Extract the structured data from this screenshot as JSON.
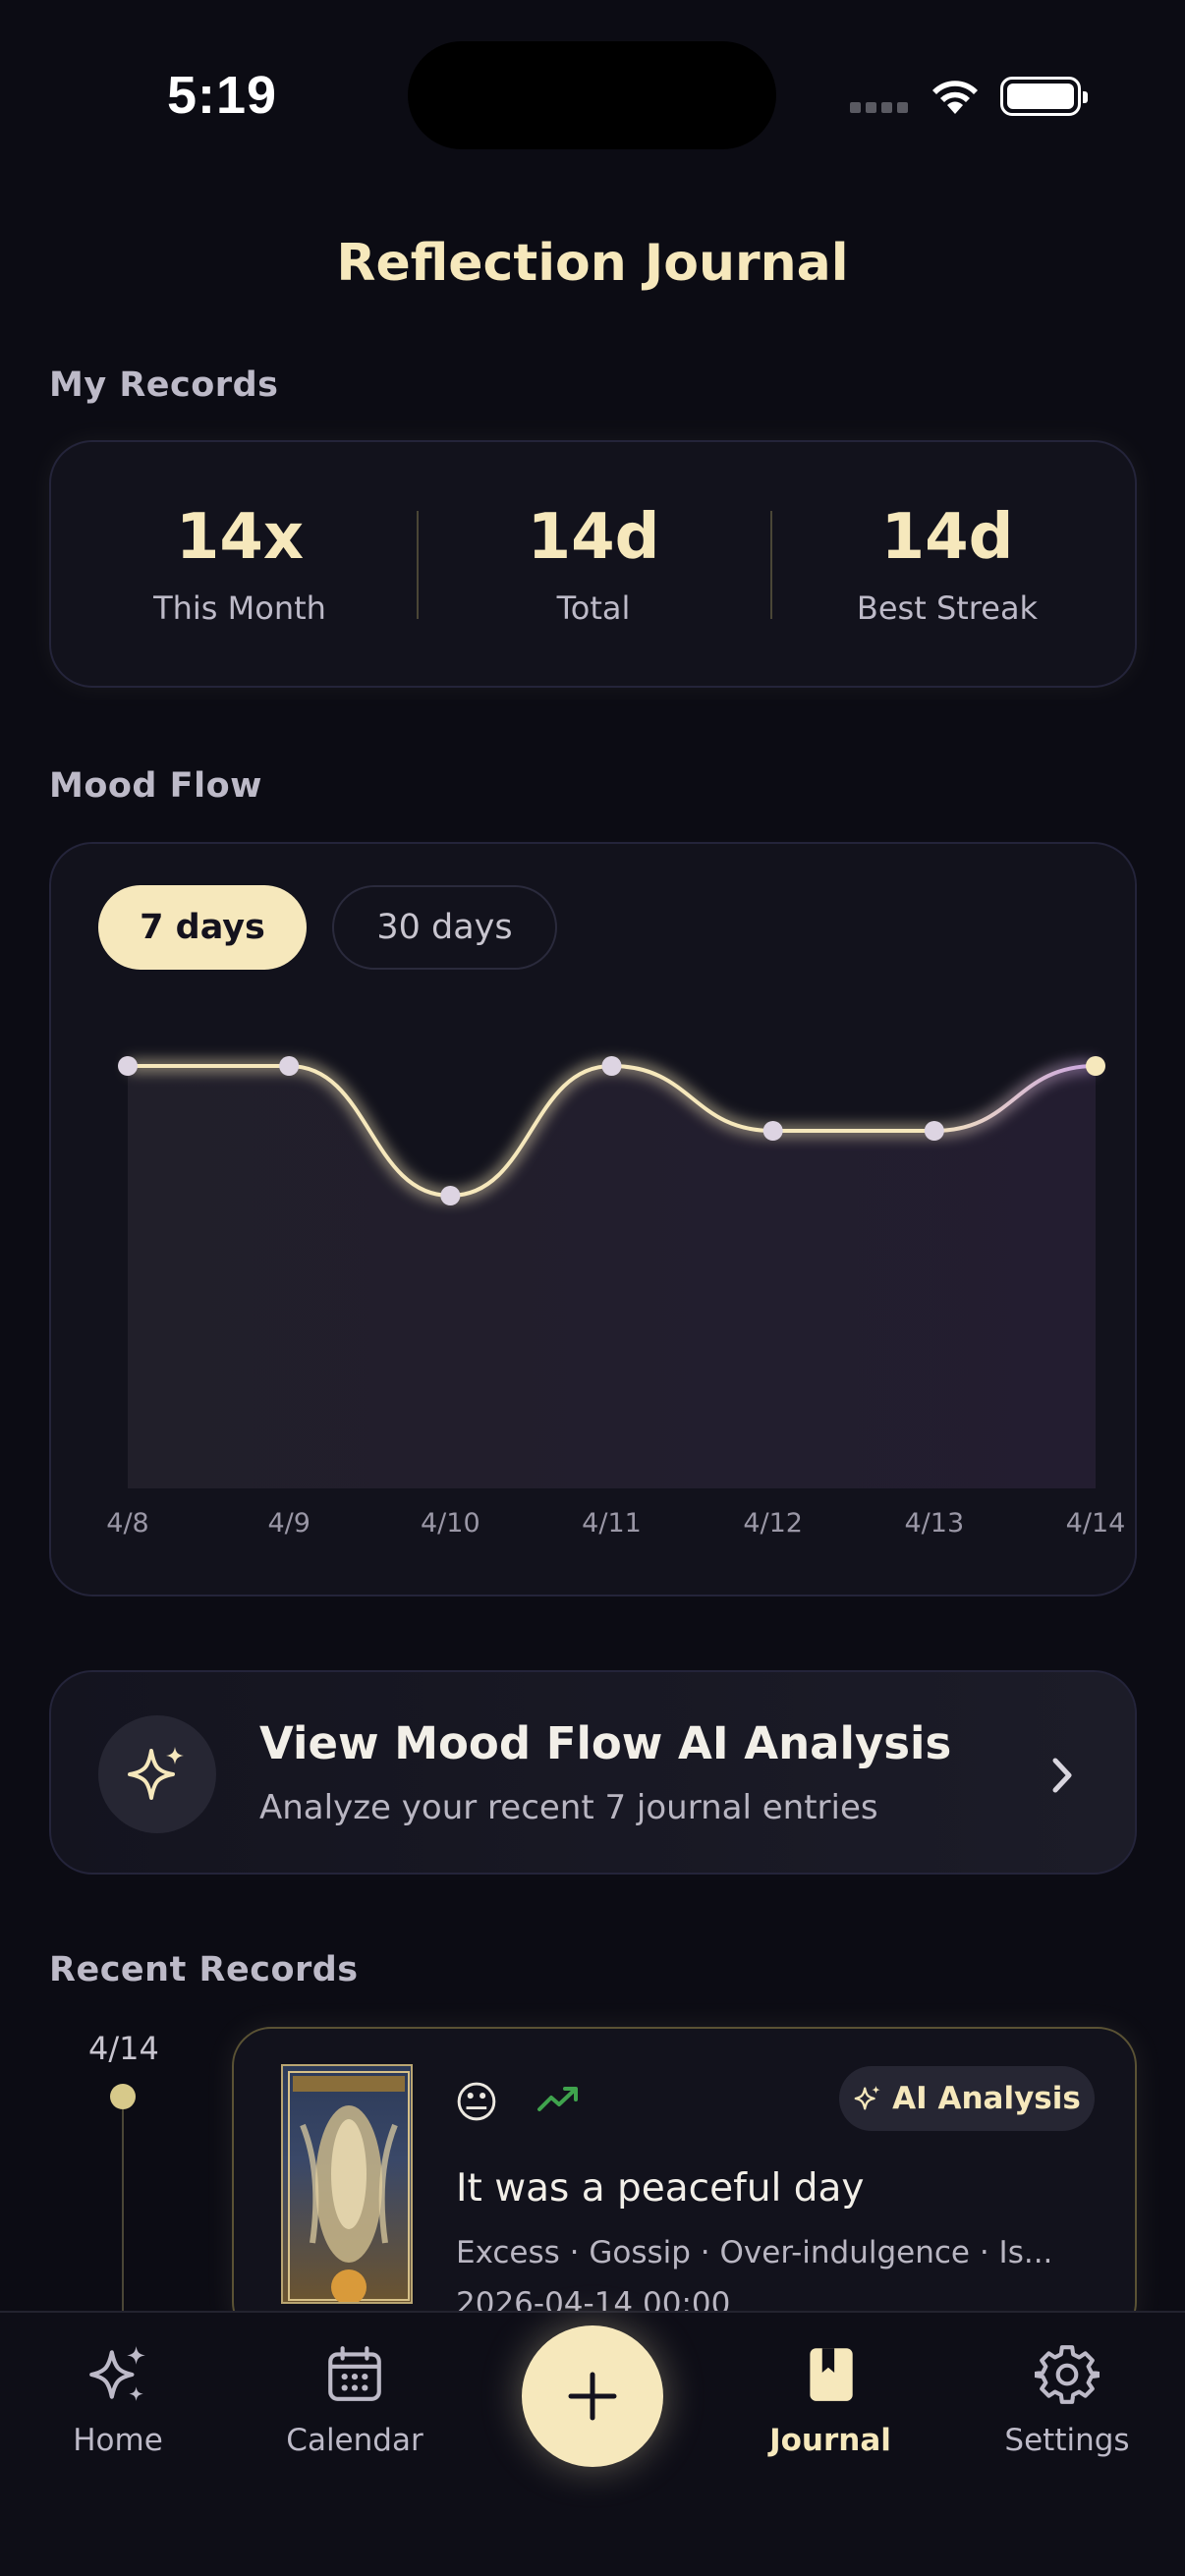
{
  "status_bar": {
    "time": "5:19"
  },
  "header": {
    "title": "Reflection Journal"
  },
  "records": {
    "section_label": "My Records",
    "stats": [
      {
        "value": "14x",
        "label": "This Month"
      },
      {
        "value": "14d",
        "label": "Total"
      },
      {
        "value": "14d",
        "label": "Best Streak"
      }
    ]
  },
  "mood_flow": {
    "section_label": "Mood Flow",
    "tabs": [
      {
        "label": "7 days",
        "active": true
      },
      {
        "label": "30 days",
        "active": false
      }
    ]
  },
  "chart_data": {
    "type": "line",
    "categories": [
      "4/8",
      "4/9",
      "4/10",
      "4/11",
      "4/12",
      "4/13",
      "4/14"
    ],
    "series": [
      {
        "values": [
          4,
          4,
          1,
          4,
          2.5,
          2.5,
          4
        ]
      }
    ],
    "ylim": [
      0,
      5
    ],
    "grid": false,
    "line_colors": [
      "#f6e8bc",
      "#c9a3e0"
    ]
  },
  "ai_card": {
    "title": "View Mood Flow AI Analysis",
    "subtitle": "Analyze your recent 7 journal entries",
    "icon": "sparkles-icon"
  },
  "recent": {
    "section_label": "Recent Records",
    "entries": [
      {
        "date": "4/14",
        "emoji": "😐",
        "trend_icon": "trending-up-icon",
        "badge": "AI Analysis",
        "title": "It was a peaceful day",
        "tags": "Excess · Gossip · Over-indulgence · Is...",
        "timestamp": "2026-04-14 00:00"
      }
    ]
  },
  "tabbar": {
    "items": [
      {
        "label": "Home",
        "icon": "sparkles-icon"
      },
      {
        "label": "Calendar",
        "icon": "calendar-icon"
      },
      {
        "label": "Journal",
        "icon": "bookmark-book-icon",
        "active": true
      },
      {
        "label": "Settings",
        "icon": "gear-icon"
      }
    ],
    "fab_icon": "plus-icon"
  },
  "colors": {
    "accent": "#f6e8bc",
    "background": "#0c0c14",
    "card": "#12121c",
    "trend_up": "#3fa34d"
  }
}
